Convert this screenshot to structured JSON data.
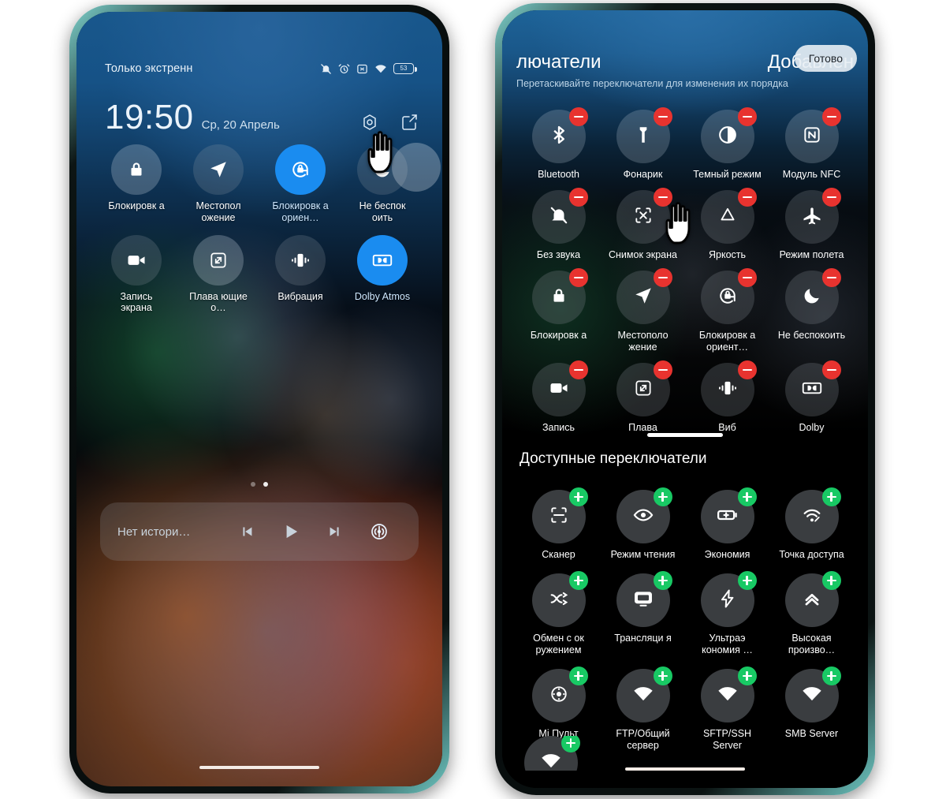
{
  "left_phone": {
    "status_bar": {
      "carrier": "Только экстренн",
      "icons": [
        "bell-muted-icon",
        "alarm-icon",
        "sim-x-icon",
        "wifi-icon",
        "battery-icon"
      ],
      "battery_percent": "53"
    },
    "clock": {
      "time": "19:50",
      "date": "Ср, 20 Апрель",
      "actions": [
        "settings-gear-icon",
        "edit-pencil-icon"
      ]
    },
    "quick_settings": [
      {
        "label": "Блокировк а",
        "icon": "lock-icon",
        "state": "off"
      },
      {
        "label": "Местопол ожение",
        "icon": "location-arrow-icon",
        "state": "off"
      },
      {
        "label": "Блокировк а ориен…",
        "icon": "rotation-lock-icon",
        "state": "on"
      },
      {
        "label": "Не беспок оить",
        "icon": "moon-icon",
        "state": "off"
      },
      {
        "label": "Запись экрана",
        "icon": "video-camera-icon",
        "state": "off"
      },
      {
        "label": "Плава ющие о…",
        "icon": "floating-window-icon",
        "state": "off"
      },
      {
        "label": "Вибрация",
        "icon": "vibration-icon",
        "state": "off"
      },
      {
        "label": "Dolby Atmos",
        "icon": "dolby-icon",
        "state": "on"
      }
    ],
    "page_dots": {
      "count": 2,
      "active_index": 1
    },
    "media_player": {
      "title": "Нет истори…",
      "controls": [
        "previous-track-icon",
        "play-icon",
        "next-track-icon",
        "cast-audio-icon"
      ]
    }
  },
  "right_phone": {
    "header": {
      "title": "лючатели",
      "add_label": "Добавлен",
      "done_button": "Готово",
      "subtitle": "Перетаскивайте переключатели для изменения их порядка"
    },
    "active_toggles": [
      {
        "label": "Bluetooth",
        "icon": "bluetooth-icon",
        "badge": "minus"
      },
      {
        "label": "Фонарик",
        "icon": "flashlight-icon",
        "badge": "minus"
      },
      {
        "label": "Темный режим",
        "icon": "dark-mode-icon",
        "badge": "minus"
      },
      {
        "label": "Модуль NFC",
        "icon": "nfc-icon",
        "badge": "minus"
      },
      {
        "label": "Без звука",
        "icon": "bell-muted-icon",
        "badge": "minus"
      },
      {
        "label": "Снимок экрана",
        "icon": "screenshot-icon",
        "badge": "minus"
      },
      {
        "label": "Яркость",
        "icon": "brightness-icon",
        "badge": "minus"
      },
      {
        "label": "Режим полета",
        "icon": "airplane-icon",
        "badge": "minus"
      },
      {
        "label": "Блокировк а",
        "icon": "lock-icon",
        "badge": "minus"
      },
      {
        "label": "Местополо жение",
        "icon": "location-arrow-icon",
        "badge": "minus"
      },
      {
        "label": "Блокировк а ориент…",
        "icon": "rotation-lock-icon",
        "badge": "minus"
      },
      {
        "label": "Не беспокоить",
        "icon": "moon-icon",
        "badge": "minus"
      },
      {
        "label": "Запись",
        "icon": "video-camera-icon",
        "badge": "minus"
      },
      {
        "label": "Плава",
        "icon": "floating-window-icon",
        "badge": "minus"
      },
      {
        "label": "Виб",
        "icon": "vibration-icon",
        "badge": "minus"
      },
      {
        "label": "Dolby",
        "icon": "dolby-icon",
        "badge": "minus"
      }
    ],
    "available_section_title": "Доступные переключатели",
    "available_toggles": [
      {
        "label": "Сканер",
        "icon": "scanner-icon",
        "badge": "plus"
      },
      {
        "label": "Режим чтения",
        "icon": "eye-icon",
        "badge": "plus"
      },
      {
        "label": "Экономия",
        "icon": "battery-saver-icon",
        "badge": "plus"
      },
      {
        "label": "Точка доступа",
        "icon": "hotspot-icon",
        "badge": "plus"
      },
      {
        "label": "Обмен с ок ружением",
        "icon": "nearby-share-icon",
        "badge": "plus"
      },
      {
        "label": "Трансляци я",
        "icon": "cast-screen-icon",
        "badge": "plus"
      },
      {
        "label": "Ультраэ кономия …",
        "icon": "ultra-battery-saver-icon",
        "badge": "plus"
      },
      {
        "label": "Высокая произво…",
        "icon": "performance-icon",
        "badge": "plus"
      },
      {
        "label": "Mi Пульт",
        "icon": "remote-control-icon",
        "badge": "plus"
      },
      {
        "label": "FTP/Общий сервер",
        "icon": "wifi-icon",
        "badge": "plus"
      },
      {
        "label": "SFTP/SSH Server",
        "icon": "wifi-icon",
        "badge": "plus"
      },
      {
        "label": "SMB Server",
        "icon": "wifi-icon",
        "badge": "plus"
      }
    ],
    "clipped_row": [
      {
        "label": "",
        "icon": "wifi-icon",
        "badge": "plus"
      }
    ]
  },
  "colors": {
    "accent_blue": "#1a8cf0",
    "badge_remove_red": "#e8332f",
    "badge_add_green": "#18c964",
    "bezel_teal": "#6fc9c4"
  }
}
